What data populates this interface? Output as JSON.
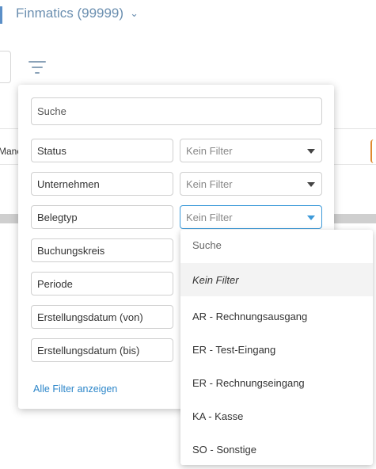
{
  "header": {
    "company": "Finmatics (99999)"
  },
  "background": {
    "column_fragment": "Manc"
  },
  "filter_panel": {
    "search_placeholder": "Suche",
    "rows": [
      {
        "label": "Status",
        "value": "Kein Filter"
      },
      {
        "label": "Unternehmen",
        "value": "Kein Filter"
      },
      {
        "label": "Belegtyp",
        "value": "Kein Filter"
      },
      {
        "label": "Buchungskreis"
      },
      {
        "label": "Periode"
      },
      {
        "label": "Erstellungsdatum (von)"
      },
      {
        "label": "Erstellungsdatum (bis)"
      }
    ],
    "all_filters_link": "Alle Filter anzeigen"
  },
  "dropdown": {
    "search_placeholder": "Suche",
    "options": [
      "Kein Filter",
      "AR - Rechnungsausgang",
      "ER - Test-Eingang",
      "ER - Rechnungseingang",
      "KA - Kasse",
      "SO - Sonstige"
    ],
    "selected": "Kein Filter"
  },
  "colors": {
    "accent": "#3d9ad9",
    "link": "#2c86c9",
    "company_text": "#6b8fb0"
  }
}
